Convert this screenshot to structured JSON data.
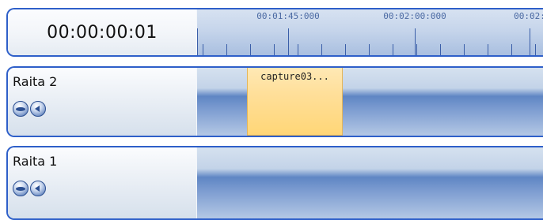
{
  "timeline": {
    "current_time": "00:00:00:01",
    "ruler_labels": [
      "00:01:45:000",
      "00:02:00:000",
      "00:02:"
    ]
  },
  "tracks": [
    {
      "name": "Raita 2",
      "icons": [
        "eye-icon",
        "speaker-icon"
      ],
      "clips": [
        {
          "label": "capture03..."
        }
      ]
    },
    {
      "name": "Raita 1",
      "icons": [
        "eye-icon",
        "speaker-icon"
      ],
      "clips": []
    }
  ],
  "colors": {
    "border": "#2e5fc9",
    "clip_fill": "#ffdf99",
    "lane": "#7b9bd0"
  }
}
